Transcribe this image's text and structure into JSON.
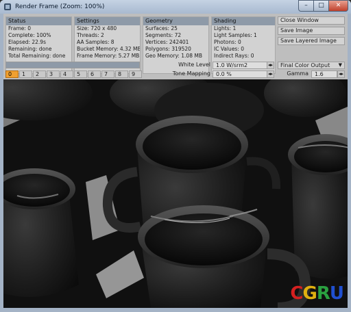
{
  "window": {
    "title": "Render Frame (Zoom: 100%)",
    "minimize_glyph": "–",
    "maximize_glyph": "□",
    "close_glyph": "✕"
  },
  "panels": {
    "status": {
      "title": "Status",
      "lines": [
        "Frame: 0",
        "Complete: 100%",
        "Elapsed: 22.9s",
        "Remaining: done",
        "Total Remaining: done"
      ]
    },
    "settings": {
      "title": "Settings",
      "lines": [
        "Size: 720 x 480",
        "Threads: 2",
        "AA Samples: 8",
        "Bucket Memory: 4.32 MB",
        "Frame Memory: 5.27 MB"
      ]
    },
    "geometry": {
      "title": "Geometry",
      "lines": [
        "Surfaces: 25",
        "Segments: 72",
        "Vertices: 242401",
        "Polygons: 319520",
        "Geo Memory: 1.08 MB"
      ]
    },
    "shading": {
      "title": "Shading",
      "lines": [
        "Lights: 1",
        "Light Samples: 1",
        "Photons: 0",
        "IC Values: 0",
        "Indirect Rays: 0"
      ]
    }
  },
  "side_buttons": [
    "Close Window",
    "Save Image",
    "Save Layered Image"
  ],
  "progress": {
    "fraction": 1.0
  },
  "frames": {
    "items": [
      "0",
      "1",
      "2",
      "3",
      "4",
      "5",
      "6",
      "7",
      "8",
      "9"
    ],
    "active": "0"
  },
  "white_level": {
    "label": "White Level",
    "value": "1.0 W/srm2"
  },
  "tone_mapping": {
    "label": "Tone Mapping",
    "value": "0.0 %"
  },
  "color_output": {
    "value": "Final Color Output"
  },
  "gamma": {
    "label": "Gamma",
    "value": "1.6"
  },
  "logo": {
    "letters": [
      "C",
      "G",
      "R",
      "U"
    ]
  },
  "colors": {
    "accent": "#f0a030",
    "panel_header": "#8e9aa8",
    "chrome": "#a4b3c6"
  }
}
